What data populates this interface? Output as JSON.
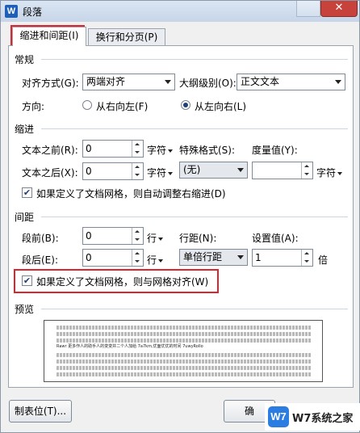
{
  "window": {
    "title": "段落",
    "close_glyph": "✕",
    "app_icon_letter": "W"
  },
  "tabs": [
    {
      "label": "缩进和间距(I)"
    },
    {
      "label": "换行和分页(P)"
    }
  ],
  "general": {
    "section_label": "常规",
    "align_label": "对齐方式(G):",
    "align_value": "两端对齐",
    "outline_label": "大纲级别(O):",
    "outline_value": "正文文本",
    "direction_label": "方向:",
    "rtl_label": "从右向左(F)",
    "ltr_label": "从左向右(L)"
  },
  "indent": {
    "section_label": "缩进",
    "before_label": "文本之前(R):",
    "before_value": "0",
    "before_unit": "字符",
    "special_label": "特殊格式(S):",
    "special_value": "(无)",
    "measure_label": "度量值(Y):",
    "measure_value": "",
    "measure_unit": "字符",
    "after_label": "文本之后(X):",
    "after_value": "0",
    "after_unit": "字符",
    "auto_adjust_label": "如果定义了文档网格，则自动调整右缩进(D)",
    "auto_adjust_checked": true
  },
  "spacing": {
    "section_label": "间距",
    "before_label": "段前(B):",
    "before_value": "0",
    "before_unit": "行",
    "line_label": "行距(N):",
    "line_value": "单倍行距",
    "set_label": "设置值(A):",
    "set_value": "1",
    "set_unit": "倍",
    "after_label": "段后(E):",
    "after_value": "0",
    "after_unit": "行",
    "grid_label": "如果定义了文档网格，则与网格对齐(W)",
    "grid_checked": true
  },
  "preview": {
    "section_label": "预览",
    "sample_text": "Rawr 更多作人的助手人的变变并二个人加给 7a7km,优面优优的时间 7uwyRollo"
  },
  "buttons": {
    "tabs_label": "制表位(T)...",
    "ok_label": "确"
  },
  "watermark": {
    "logo_text": "W7",
    "site_text": "W7系统之家"
  },
  "colors": {
    "highlight": "#e0242b",
    "accent": "#1d3f7a"
  }
}
